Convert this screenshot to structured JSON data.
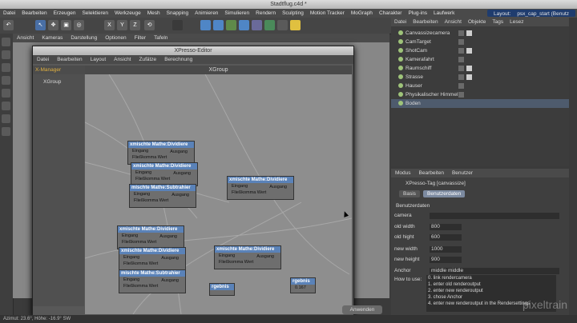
{
  "window": {
    "title": "Stadtflug.c4d *"
  },
  "menubar": [
    "Datei",
    "Bearbeiten",
    "Erzeugen",
    "Selektieren",
    "Werkzeuge",
    "Mesh",
    "Snapping",
    "Animieren",
    "Simulieren",
    "Rendern",
    "Sculpting",
    "Motion Tracker",
    "MoGraph",
    "Charakter",
    "Plug-ins",
    "Laufwerk"
  ],
  "layout": {
    "label": "Layout:",
    "value": "psx_cap_start (Benutz"
  },
  "toolbar": [
    "↶",
    "↖",
    "✥",
    "▣",
    "◎",
    "X",
    "Y",
    "Z",
    "⟲"
  ],
  "viewport_menu": [
    "Ansicht",
    "Kameras",
    "Darstellung",
    "Optionen",
    "Filter",
    "Tafeln"
  ],
  "objects": {
    "menu": [
      "Datei",
      "Bearbeiten",
      "Ansicht",
      "Objekte",
      "Tags",
      "Lesez"
    ],
    "items": [
      {
        "name": "Canvassizecamera",
        "selected": false
      },
      {
        "name": "CamTarget",
        "selected": false
      },
      {
        "name": "ShotCam",
        "selected": false
      },
      {
        "name": "Kamerafahrt",
        "selected": false
      },
      {
        "name": "Raumschiff",
        "selected": false
      },
      {
        "name": "Strasse",
        "selected": false
      },
      {
        "name": "Hauser",
        "selected": false
      },
      {
        "name": "Physikalischer Himmel",
        "selected": false
      },
      {
        "name": "Boden",
        "selected": true
      }
    ]
  },
  "attributes": {
    "menu": [
      "Modus",
      "Bearbeiten",
      "Benutzer"
    ],
    "header": "XPresso-Tag [canvassize]",
    "tabs": [
      "Basis",
      "Benutzerdaten"
    ],
    "section": "Benutzerdaten",
    "fields": [
      {
        "label": "camera",
        "value": ""
      },
      {
        "label": "old width",
        "value": "800"
      },
      {
        "label": "old hight",
        "value": "600"
      },
      {
        "label": "new width",
        "value": "1000"
      },
      {
        "label": "new height",
        "value": "900"
      },
      {
        "label": "Anchor",
        "value": "middle middle"
      }
    ],
    "howto_label": "How to use:",
    "howto": [
      "0. link rendercamera",
      "1. enter old renderoutput",
      "2. enter new renderoutput",
      "3. chose Anchor",
      "4. enter new renderoutput in the Rendersettings"
    ]
  },
  "xpresso": {
    "title": "XPresso-Editor",
    "menu": [
      "Datei",
      "Bearbeiten",
      "Layout",
      "Ansicht",
      "Zufätze",
      "Berechnung"
    ],
    "manager_tab": "X-Manager",
    "manager_item": "XGroup",
    "canvas_title": "XGroup",
    "apply": "Anwenden",
    "nodes": [
      {
        "title": "xmischte Mathe:Dividiere",
        "in1": "Eingang",
        "in2": "Fließkomma Wert",
        "out": "Ausgang"
      },
      {
        "title": "xmischte Mathe:Dividiere",
        "in1": "Eingang",
        "in2": "Fließkomma Wert",
        "out": "Ausgang"
      },
      {
        "title": "mischte Mathe:Subtrahier",
        "in1": "Eingang",
        "in2": "Fließkomma Wert",
        "out": "Ausgang"
      },
      {
        "title": "xmischte Mathe:Dividiere",
        "in1": "Eingang",
        "in2": "Fließkomma Wert",
        "out": "Ausgang"
      },
      {
        "title": "xmischte Mathe:Dividiere",
        "in1": "Eingang",
        "in2": "Fließkomma Wert",
        "out": "Ausgang"
      },
      {
        "title": "xmischte Mathe:Dividiere",
        "in1": "Eingang",
        "in2": "Fließkomma Wert",
        "out": "Ausgang"
      },
      {
        "title": "mischte Mathe:Subtrahier",
        "in1": "Eingang",
        "in2": "Fließkomma Wert",
        "out": "Ausgang"
      },
      {
        "title": "xmischte Mathe:Dividiere",
        "in1": "Eingang",
        "in2": "Fließkomma Wert",
        "out": "Ausgang"
      }
    ],
    "result_nodes": [
      {
        "title": "rgebnis"
      },
      {
        "title": "rgebnis",
        "value": "0.167"
      }
    ]
  },
  "status": {
    "text": "Azimut: 23.6°, Höhe: -16.9°  SW"
  },
  "watermark": "pixeltrain",
  "colors": {
    "accent": "#5a82b8",
    "selection": "#4e5b6d",
    "layout_box": "#1f3c6e"
  }
}
